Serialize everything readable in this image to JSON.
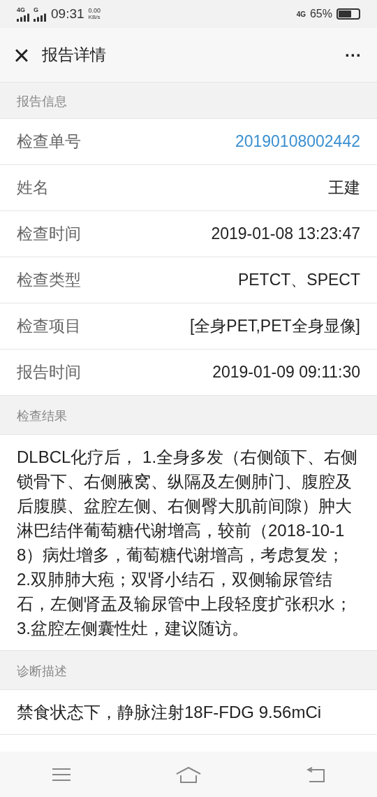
{
  "status_bar": {
    "network_1": "4G",
    "network_2": "G",
    "time": "09:31",
    "speed": "0.00",
    "speed_unit": "KB/s",
    "network_3": "4G",
    "battery": "65%"
  },
  "header": {
    "title": "报告详情",
    "close_icon": "×",
    "more": "···"
  },
  "sections": [
    {
      "title": "报告信息",
      "kind": "fields",
      "rows": [
        {
          "label": "检查单号",
          "value": "20190108002442",
          "link": true
        },
        {
          "label": "姓名",
          "value": "王建",
          "link": false
        },
        {
          "label": "检查时间",
          "value": "2019-01-08 13:23:47",
          "link": false
        },
        {
          "label": "检查类型",
          "value": "PETCT、SPECT",
          "link": false
        },
        {
          "label": "检查项目",
          "value": "[全身PET,PET全身显像]",
          "link": false
        },
        {
          "label": "报告时间",
          "value": "2019-01-09 09:11:30",
          "link": false
        }
      ]
    },
    {
      "title": "检查结果",
      "kind": "text",
      "text": "DLBCL化疗后， 1.全身多发（右侧颌下、右侧锁骨下、右侧腋窝、纵隔及左侧肺门、腹腔及后腹膜、盆腔左侧、右侧臀大肌前间隙）肿大淋巴结伴葡萄糖代谢增高，较前（2018-10-18）病灶增多，葡萄糖代谢增高，考虑复发； 2.双肺肺大疱；双肾小结石，双侧输尿管结石，左侧肾盂及输尿管中上段轻度扩张积水； 3.盆腔左侧囊性灶，建议随访。"
    },
    {
      "title": "诊断描述",
      "kind": "text",
      "text": "禁食状态下，静脉注射18F-FDG 9.56mCi"
    }
  ]
}
